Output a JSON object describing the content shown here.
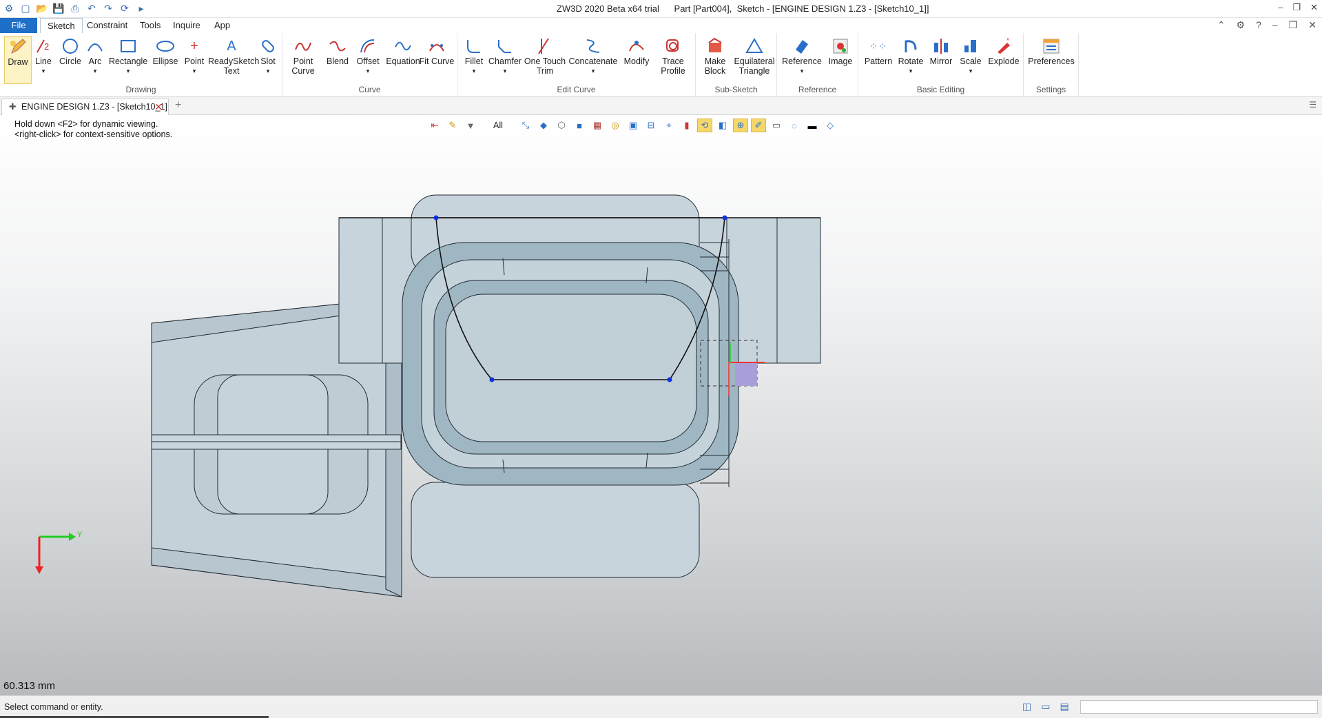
{
  "app": {
    "title": "ZW3D 2020 Beta x64 trial",
    "context": "Part [Part004],  Sketch - [ENGINE DESIGN 1.Z3 - [Sketch10_1]]"
  },
  "menu": {
    "file": "File",
    "tabs": [
      "Sketch",
      "Constraint",
      "Tools",
      "Inquire",
      "App"
    ]
  },
  "ribbon": {
    "groups": {
      "drawing": "Drawing",
      "curve": "Curve",
      "edit_curve": "Edit Curve",
      "sub_sketch": "Sub-Sketch",
      "reference": "Reference",
      "basic_editing": "Basic Editing",
      "settings": "Settings"
    },
    "buttons": {
      "draw": "Draw",
      "line": "Line",
      "circle": "Circle",
      "arc": "Arc",
      "rectangle": "Rectangle",
      "ellipse": "Ellipse",
      "point": "Point",
      "readysketch_1": "ReadySketch",
      "readysketch_2": "Text",
      "slot": "Slot",
      "point_curve_1": "Point",
      "point_curve_2": "Curve",
      "blend": "Blend",
      "offset": "Offset",
      "equation": "Equation",
      "fit_curve": "Fit Curve",
      "fillet": "Fillet",
      "chamfer": "Chamfer",
      "one_touch_1": "One Touch",
      "one_touch_2": "Trim",
      "concatenate": "Concatenate",
      "modify": "Modify",
      "trace_1": "Trace",
      "trace_2": "Profile",
      "make_block_1": "Make",
      "make_block_2": "Block",
      "eq_tri_1": "Equilateral",
      "eq_tri_2": "Triangle",
      "reference": "Reference",
      "image": "Image",
      "pattern": "Pattern",
      "rotate": "Rotate",
      "mirror": "Mirror",
      "scale": "Scale",
      "explode": "Explode",
      "preferences": "Preferences"
    }
  },
  "doc_tab": {
    "label": "ENGINE DESIGN 1.Z3 - [Sketch10_1]"
  },
  "viewport": {
    "hint_1": "Hold down <F2> for dynamic viewing.",
    "hint_2": "<right-click> for context-sensitive options.",
    "filter": "All",
    "coordinate": "60.313 mm",
    "axis_y": "Y"
  },
  "status": {
    "message": "Select command or entity."
  },
  "colors": {
    "file_tab": "#1e6fc8",
    "part_fill": "#c2d0d8",
    "channel_fill": "#9fb6c3",
    "point": "#1030e0"
  }
}
